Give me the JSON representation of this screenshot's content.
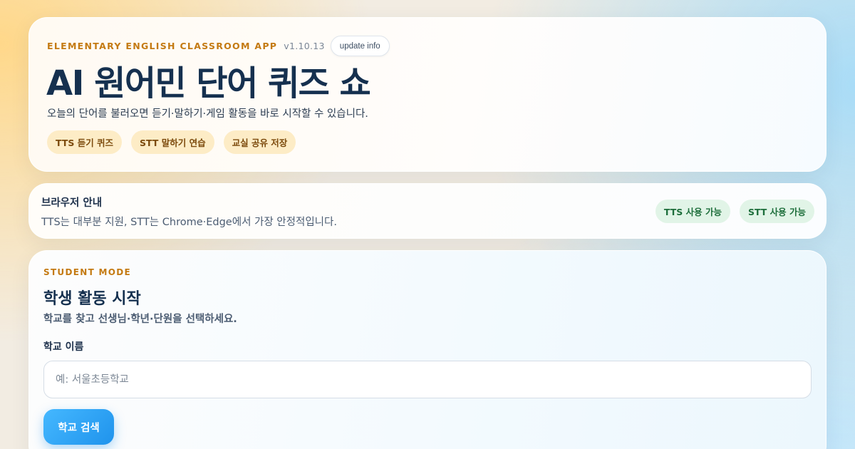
{
  "hero": {
    "eyebrow": "ELEMENTARY ENGLISH CLASSROOM APP",
    "version": "v1.10.13",
    "update_label": "update info",
    "title": "AI 원어민 단어 퀴즈 쇼",
    "subtitle": "오늘의 단어를 불러오면 듣기·말하기·게임 활동을 바로 시작할 수 있습니다.",
    "pills": [
      "TTS 듣기 퀴즈",
      "STT 말하기 연습",
      "교실 공유 저장"
    ]
  },
  "browser": {
    "title": "브라우저 안내",
    "description": "TTS는 대부분 지원, STT는 Chrome·Edge에서 가장 안정적입니다.",
    "badges": [
      "TTS 사용 가능",
      "STT 사용 가능"
    ]
  },
  "student": {
    "eyebrow": "STUDENT MODE",
    "title": "학생 활동 시작",
    "subtitle": "학교를 찾고 선생님·학년·단원을 선택하세요.",
    "school_label": "학교 이름",
    "school_placeholder": "예: 서울초등학교",
    "school_value": "",
    "search_label": "학교 검색"
  },
  "colors": {
    "accent_orange": "#c47a12",
    "primary_blue": "#1f93ec",
    "status_green": "#1d6e3b"
  }
}
